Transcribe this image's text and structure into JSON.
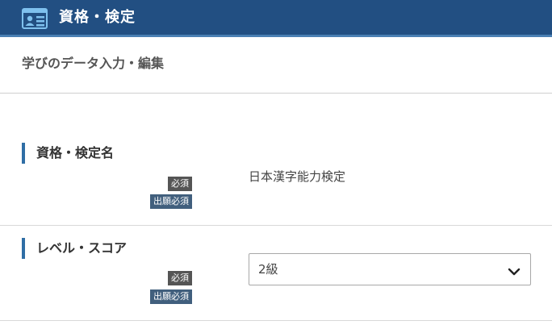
{
  "header": {
    "title": "資格・検定",
    "icon": "id-card-icon",
    "background": "#224f82"
  },
  "subheader": {
    "title": "学びのデータ入力・編集"
  },
  "fields": [
    {
      "label": "資格・検定名",
      "required_badge": "必須",
      "application_badge": "出願必須",
      "value": "日本漢字能力検定"
    },
    {
      "label": "レベル・スコア",
      "required_badge": "必須",
      "application_badge": "出願必須",
      "selected": "2級",
      "icon": "chevron-down-icon"
    }
  ],
  "colors": {
    "accent": "#2f6ea5",
    "badge_required": "#555555",
    "badge_application": "#415f7d"
  }
}
